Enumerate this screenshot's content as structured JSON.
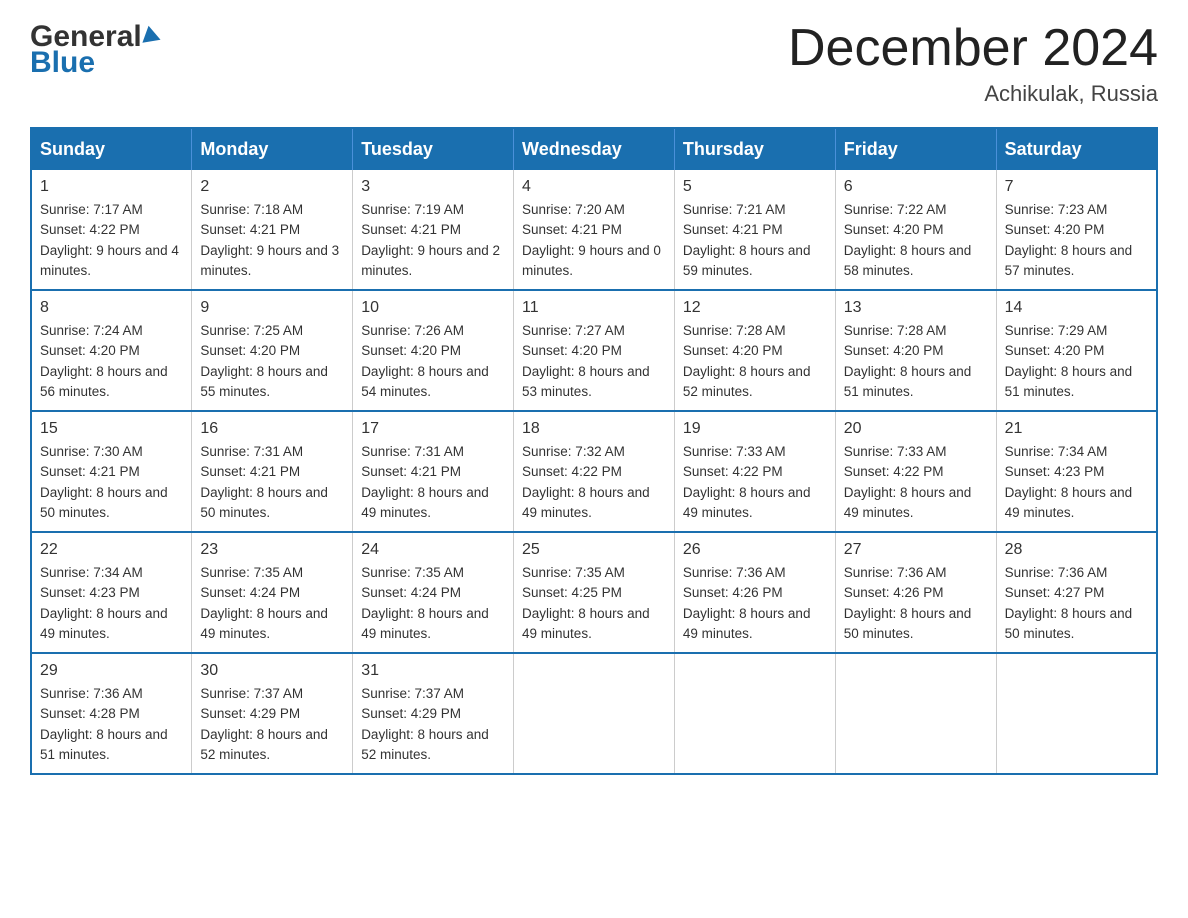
{
  "header": {
    "logo_line1": "General",
    "logo_line2": "Blue",
    "month_title": "December 2024",
    "location": "Achikulak, Russia"
  },
  "calendar": {
    "days_of_week": [
      "Sunday",
      "Monday",
      "Tuesday",
      "Wednesday",
      "Thursday",
      "Friday",
      "Saturday"
    ],
    "weeks": [
      [
        {
          "day": "1",
          "sunrise": "7:17 AM",
          "sunset": "4:22 PM",
          "daylight": "9 hours and 4 minutes."
        },
        {
          "day": "2",
          "sunrise": "7:18 AM",
          "sunset": "4:21 PM",
          "daylight": "9 hours and 3 minutes."
        },
        {
          "day": "3",
          "sunrise": "7:19 AM",
          "sunset": "4:21 PM",
          "daylight": "9 hours and 2 minutes."
        },
        {
          "day": "4",
          "sunrise": "7:20 AM",
          "sunset": "4:21 PM",
          "daylight": "9 hours and 0 minutes."
        },
        {
          "day": "5",
          "sunrise": "7:21 AM",
          "sunset": "4:21 PM",
          "daylight": "8 hours and 59 minutes."
        },
        {
          "day": "6",
          "sunrise": "7:22 AM",
          "sunset": "4:20 PM",
          "daylight": "8 hours and 58 minutes."
        },
        {
          "day": "7",
          "sunrise": "7:23 AM",
          "sunset": "4:20 PM",
          "daylight": "8 hours and 57 minutes."
        }
      ],
      [
        {
          "day": "8",
          "sunrise": "7:24 AM",
          "sunset": "4:20 PM",
          "daylight": "8 hours and 56 minutes."
        },
        {
          "day": "9",
          "sunrise": "7:25 AM",
          "sunset": "4:20 PM",
          "daylight": "8 hours and 55 minutes."
        },
        {
          "day": "10",
          "sunrise": "7:26 AM",
          "sunset": "4:20 PM",
          "daylight": "8 hours and 54 minutes."
        },
        {
          "day": "11",
          "sunrise": "7:27 AM",
          "sunset": "4:20 PM",
          "daylight": "8 hours and 53 minutes."
        },
        {
          "day": "12",
          "sunrise": "7:28 AM",
          "sunset": "4:20 PM",
          "daylight": "8 hours and 52 minutes."
        },
        {
          "day": "13",
          "sunrise": "7:28 AM",
          "sunset": "4:20 PM",
          "daylight": "8 hours and 51 minutes."
        },
        {
          "day": "14",
          "sunrise": "7:29 AM",
          "sunset": "4:20 PM",
          "daylight": "8 hours and 51 minutes."
        }
      ],
      [
        {
          "day": "15",
          "sunrise": "7:30 AM",
          "sunset": "4:21 PM",
          "daylight": "8 hours and 50 minutes."
        },
        {
          "day": "16",
          "sunrise": "7:31 AM",
          "sunset": "4:21 PM",
          "daylight": "8 hours and 50 minutes."
        },
        {
          "day": "17",
          "sunrise": "7:31 AM",
          "sunset": "4:21 PM",
          "daylight": "8 hours and 49 minutes."
        },
        {
          "day": "18",
          "sunrise": "7:32 AM",
          "sunset": "4:22 PM",
          "daylight": "8 hours and 49 minutes."
        },
        {
          "day": "19",
          "sunrise": "7:33 AM",
          "sunset": "4:22 PM",
          "daylight": "8 hours and 49 minutes."
        },
        {
          "day": "20",
          "sunrise": "7:33 AM",
          "sunset": "4:22 PM",
          "daylight": "8 hours and 49 minutes."
        },
        {
          "day": "21",
          "sunrise": "7:34 AM",
          "sunset": "4:23 PM",
          "daylight": "8 hours and 49 minutes."
        }
      ],
      [
        {
          "day": "22",
          "sunrise": "7:34 AM",
          "sunset": "4:23 PM",
          "daylight": "8 hours and 49 minutes."
        },
        {
          "day": "23",
          "sunrise": "7:35 AM",
          "sunset": "4:24 PM",
          "daylight": "8 hours and 49 minutes."
        },
        {
          "day": "24",
          "sunrise": "7:35 AM",
          "sunset": "4:24 PM",
          "daylight": "8 hours and 49 minutes."
        },
        {
          "day": "25",
          "sunrise": "7:35 AM",
          "sunset": "4:25 PM",
          "daylight": "8 hours and 49 minutes."
        },
        {
          "day": "26",
          "sunrise": "7:36 AM",
          "sunset": "4:26 PM",
          "daylight": "8 hours and 49 minutes."
        },
        {
          "day": "27",
          "sunrise": "7:36 AM",
          "sunset": "4:26 PM",
          "daylight": "8 hours and 50 minutes."
        },
        {
          "day": "28",
          "sunrise": "7:36 AM",
          "sunset": "4:27 PM",
          "daylight": "8 hours and 50 minutes."
        }
      ],
      [
        {
          "day": "29",
          "sunrise": "7:36 AM",
          "sunset": "4:28 PM",
          "daylight": "8 hours and 51 minutes."
        },
        {
          "day": "30",
          "sunrise": "7:37 AM",
          "sunset": "4:29 PM",
          "daylight": "8 hours and 52 minutes."
        },
        {
          "day": "31",
          "sunrise": "7:37 AM",
          "sunset": "4:29 PM",
          "daylight": "8 hours and 52 minutes."
        },
        null,
        null,
        null,
        null
      ]
    ],
    "labels": {
      "sunrise": "Sunrise:",
      "sunset": "Sunset:",
      "daylight": "Daylight:"
    }
  }
}
